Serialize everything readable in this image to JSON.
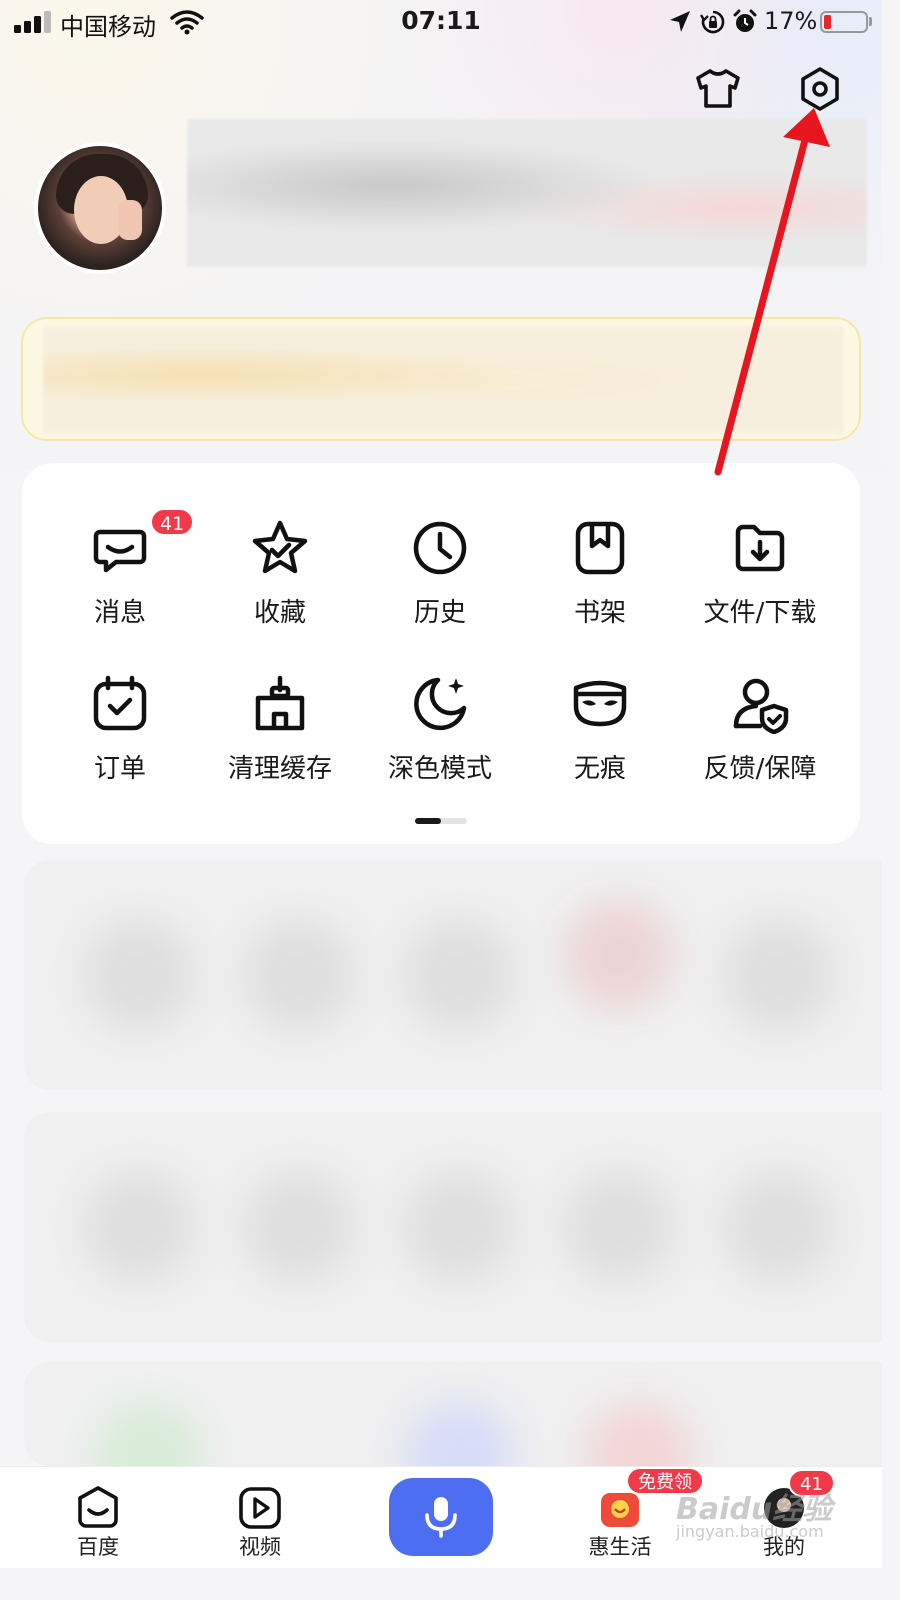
{
  "status_bar": {
    "carrier": "中国移动",
    "time": "07:11",
    "battery_percent": "17%",
    "battery_level": 0.17,
    "icons": [
      "signal-icon",
      "wifi-icon",
      "location-icon",
      "rotation-lock-icon",
      "alarm-icon",
      "battery-icon"
    ]
  },
  "header": {
    "icons": [
      "skin-shirt-icon",
      "settings-icon"
    ]
  },
  "tools": [
    {
      "label": "消息",
      "icon": "message-icon",
      "badge": "41"
    },
    {
      "label": "收藏",
      "icon": "star-icon"
    },
    {
      "label": "历史",
      "icon": "clock-icon"
    },
    {
      "label": "书架",
      "icon": "bookshelf-icon"
    },
    {
      "label": "文件/下载",
      "icon": "folder-download-icon"
    },
    {
      "label": "订单",
      "icon": "order-icon"
    },
    {
      "label": "清理缓存",
      "icon": "clean-cache-icon"
    },
    {
      "label": "深色模式",
      "icon": "moon-icon"
    },
    {
      "label": "无痕",
      "icon": "mask-icon"
    },
    {
      "label": "反馈/保障",
      "icon": "feedback-shield-icon"
    }
  ],
  "pager": {
    "pages": 2,
    "active": 1
  },
  "tabbar": {
    "tabs": [
      {
        "label": "百度",
        "icon": "baidu-home-icon"
      },
      {
        "label": "视频",
        "icon": "video-play-icon"
      },
      {
        "label": "惠生活",
        "icon": "hui-life-icon",
        "badge": "免费领"
      },
      {
        "label": "我的",
        "icon": "my-avatar-icon",
        "badge": "41"
      }
    ],
    "voice_icon": "microphone-icon"
  },
  "watermark": {
    "text": "Baidu经验",
    "sub": "jingyan.baidu.com"
  },
  "colors": {
    "accent": "#4e6ef2",
    "badge_red": "#f03a4a",
    "arrow_red": "#e8141e"
  }
}
